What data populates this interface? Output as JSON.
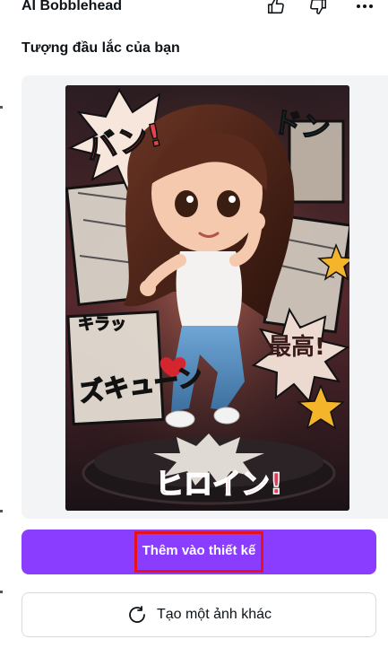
{
  "app": {
    "title": "AI Bobblehead"
  },
  "header_icons": [
    "thumbs-up-icon",
    "thumbs-down-icon",
    "more-options-icon"
  ],
  "section": {
    "title": "Tượng đầu lắc của bạn"
  },
  "image": {
    "alt": "Bobblehead",
    "art_text": {
      "ban": "バン!",
      "don": "ドン",
      "kira": "キラッ",
      "zukyun": "ズキューン",
      "saikou": "最高!",
      "heroine": "ヒロイン!"
    }
  },
  "actions": {
    "add_to_design": "Thêm vào thiết kế",
    "regenerate": "Tạo một ảnh khác"
  },
  "colors": {
    "accent": "#8b3dff",
    "highlight_box": "#e8121c"
  }
}
